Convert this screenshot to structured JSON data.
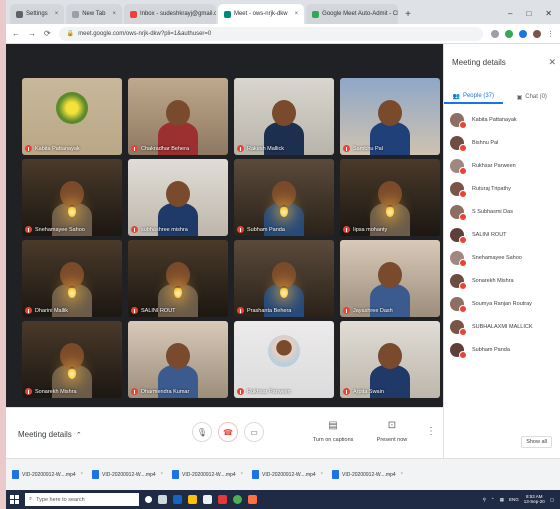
{
  "browser": {
    "tabs": [
      {
        "label": "Settings",
        "fav": "#5f6368",
        "active": false
      },
      {
        "label": "New Tab",
        "fav": "#9aa0a6",
        "active": false
      },
      {
        "label": "Inbox - sudeshkrayj@gmail.c",
        "fav": "#ea4335",
        "active": false
      },
      {
        "label": "Meet - ows-nrjk-dkw",
        "fav": "#00897b",
        "active": true
      },
      {
        "label": "Google Meet Auto-Admit - Chr",
        "fav": "#34a853",
        "active": false
      }
    ],
    "url": "meet.google.com/ows-nrjk-dkw?pli=1&authuser=0"
  },
  "participants_grid": [
    {
      "name": "Kabita Pattanayak",
      "kind": "avatar-flower"
    },
    {
      "name": "Chakradhar Behera",
      "kind": "boy"
    },
    {
      "name": "Rakesh Mallick",
      "kind": "officer"
    },
    {
      "name": "Sambhu Pal",
      "kind": "scouts"
    },
    {
      "name": "Snehamayee Sahoo",
      "kind": "lamp-room"
    },
    {
      "name": "subhashree mishra",
      "kind": "guide"
    },
    {
      "name": "Subham Panda",
      "kind": "guide-lamp"
    },
    {
      "name": "Iipsa mohanty",
      "kind": "lamp-room"
    },
    {
      "name": "Dharini Mallik",
      "kind": "lamp-room"
    },
    {
      "name": "SALINI ROUT",
      "kind": "lamp-room"
    },
    {
      "name": "Prashanta Behera",
      "kind": "guide-lamp"
    },
    {
      "name": "Jayashree Dash",
      "kind": "girl"
    },
    {
      "name": "Sonarekh Mishra",
      "kind": "lamp-room"
    },
    {
      "name": "Dharmendra Kumar",
      "kind": "girl"
    },
    {
      "name": "Rukhsar Parween",
      "kind": "girl-avatar"
    },
    {
      "name": "Arpita Swain",
      "kind": "guide"
    }
  ],
  "controls": {
    "meeting_details": "Meeting details",
    "captions": "Turn on captions",
    "present": "Present now"
  },
  "panel": {
    "title": "Meeting details",
    "people_tab": "People (37)",
    "chat_tab": "Chat (0)",
    "people": [
      "Kabita Pattanayak",
      "Bishnu Pal",
      "Rukhsar Parween",
      "Ruturaj Tripathy",
      "S Subhasmi Das",
      "SALINI ROUT",
      "Snehamayee Sahoo",
      "Sonarekh Mishra",
      "Soumya Ranjan Routray",
      "SUBHALAXMI MALLICK",
      "Subham Panda"
    ],
    "show_all": "Show all"
  },
  "downloads": [
    "VID-20200912-W....mp4",
    "VID-20200912-W....mp4",
    "VID-20200912-W....mp4",
    "VID-20200912-W....mp4",
    "VID-20200912-W....mp4"
  ],
  "taskbar": {
    "search_placeholder": "Type here to search",
    "lang": "ENG",
    "time": "8:53 AM",
    "date": "13-Sep-20"
  },
  "colors": {
    "stage_bg": "#202124",
    "accent": "#1a73e8",
    "mic_off": "#ea4335"
  }
}
